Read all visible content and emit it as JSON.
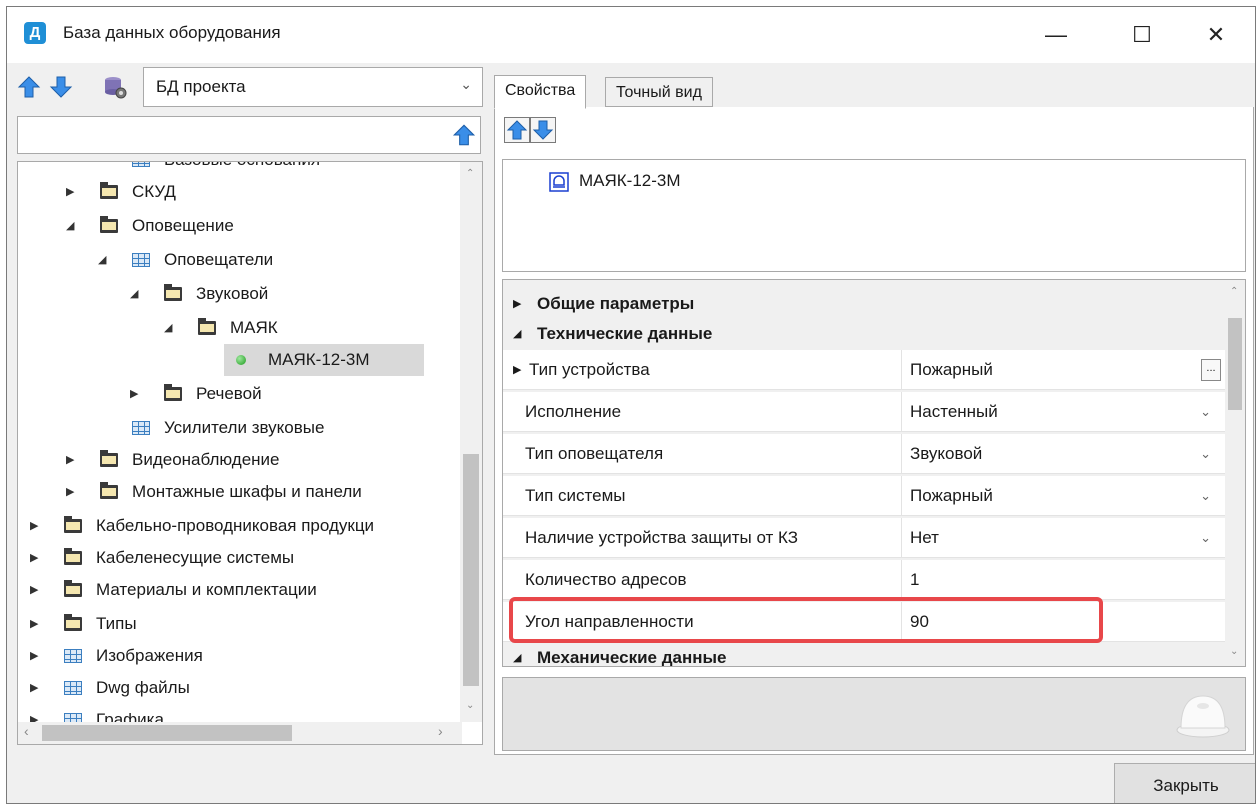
{
  "window": {
    "title": "База данных оборудования",
    "minimize_glyph": "—",
    "maximize_glyph": "☐",
    "close_glyph": "✕",
    "app_icon_letter": "Д"
  },
  "left_panel": {
    "db_select": {
      "value": "БД проекта"
    },
    "search": {
      "value": ""
    },
    "tree": [
      {
        "label": "Базовые основания",
        "icon": "table",
        "expander": ""
      },
      {
        "label": "СКУД",
        "icon": "folder",
        "expander": "collapsed"
      },
      {
        "label": "Оповещение",
        "icon": "folder-open",
        "expander": "expanded"
      },
      {
        "label": "Оповещатели",
        "icon": "table",
        "expander": "expanded"
      },
      {
        "label": "Звуковой",
        "icon": "folder-open",
        "expander": "expanded"
      },
      {
        "label": "МАЯК",
        "icon": "folder-open",
        "expander": "expanded"
      },
      {
        "label": "МАЯК-12-3М",
        "icon": "green-dot",
        "expander": "",
        "selected": true
      },
      {
        "label": "Речевой",
        "icon": "folder",
        "expander": "collapsed"
      },
      {
        "label": "Усилители звуковые",
        "icon": "table",
        "expander": ""
      },
      {
        "label": "Видеонаблюдение",
        "icon": "folder",
        "expander": "collapsed"
      },
      {
        "label": "Монтажные шкафы и панели",
        "icon": "folder",
        "expander": "collapsed"
      },
      {
        "label": "Кабельно-проводниковая продукци",
        "icon": "folder",
        "expander": "collapsed"
      },
      {
        "label": "Кабеленесущие системы",
        "icon": "folder",
        "expander": "collapsed"
      },
      {
        "label": "Материалы и комплектации",
        "icon": "folder",
        "expander": "collapsed"
      },
      {
        "label": "Типы",
        "icon": "folder",
        "expander": "collapsed"
      },
      {
        "label": "Изображения",
        "icon": "table",
        "expander": "collapsed"
      },
      {
        "label": "Dwg файлы",
        "icon": "table",
        "expander": "collapsed"
      },
      {
        "label": "Графика",
        "icon": "table",
        "expander": "collapsed"
      }
    ]
  },
  "right_panel": {
    "tabs": [
      {
        "label": "Свойства",
        "active": true
      },
      {
        "label": "Точный вид",
        "active": false
      }
    ],
    "preview_item": {
      "label": "МАЯК-12-3М"
    },
    "categories": {
      "general": "Общие параметры",
      "technical": "Технические данные",
      "mechanical": "Механические данные"
    },
    "properties": [
      {
        "name": "Тип устройства",
        "value": "Пожарный",
        "control": "ellipsis",
        "expandable": true
      },
      {
        "name": "Исполнение",
        "value": "Настенный",
        "control": "dropdown"
      },
      {
        "name": "Тип оповещателя",
        "value": "Звуковой",
        "control": "dropdown"
      },
      {
        "name": "Тип системы",
        "value": "Пожарный",
        "control": "dropdown"
      },
      {
        "name": "Наличие устройства защиты от КЗ",
        "value": "Нет",
        "control": "dropdown"
      },
      {
        "name": "Количество адресов",
        "value": "1",
        "control": "text"
      },
      {
        "name": "Угол направленности",
        "value": "90",
        "control": "text",
        "highlighted": true
      }
    ],
    "highlight_color": "#e8474a"
  },
  "footer": {
    "close_label": "Закрыть"
  },
  "colors": {
    "accent_blue": "#1f8fd6",
    "selection": "#d9d9d9"
  }
}
